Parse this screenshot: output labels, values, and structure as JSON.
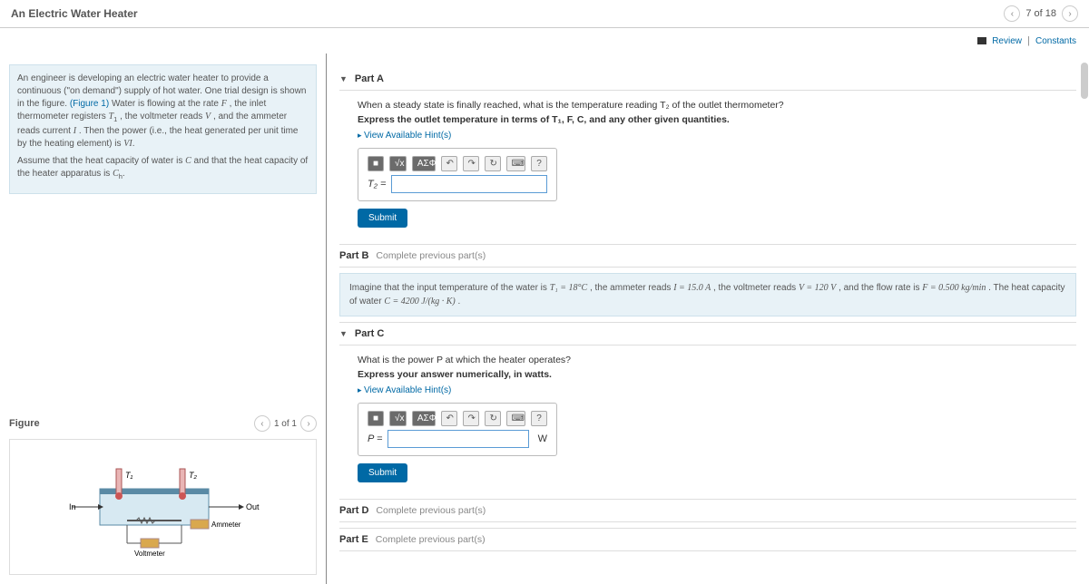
{
  "header": {
    "title": "An Electric Water Heater",
    "page_indicator": "7 of 18"
  },
  "top_links": {
    "review": "Review",
    "constants": "Constants"
  },
  "intro": {
    "p1_a": "An engineer is developing an electric water heater to provide a continuous (\"on demand\") supply of hot water. One trial design is shown in the figure. ",
    "fig_link": "(Figure 1)",
    "p1_b": "Water is flowing at the rate ",
    "p1_c": ", the inlet thermometer registers ",
    "p1_d": ", the voltmeter reads ",
    "p1_e": ", and the ammeter reads current ",
    "p1_f": ". Then the power (i.e., the heat generated per unit time by the heating element) is ",
    "p1_g": ".",
    "p2_a": "Assume that the heat capacity of water is ",
    "p2_b": " and that the heat capacity of the heater apparatus is ",
    "p2_c": "."
  },
  "figure": {
    "label": "Figure",
    "pager": "1 of 1",
    "labels": {
      "in": "In",
      "out": "Out",
      "t1": "T₁",
      "t2": "T₂",
      "amm": "Ammeter",
      "volt": "Voltmeter"
    }
  },
  "partA": {
    "title": "Part A",
    "q": "When a steady state is finally reached, what is the temperature reading T₂ of the outlet thermometer?",
    "instr": "Express the outlet temperature in terms of T₁, F, C, and any other given quantities.",
    "hint": "View Available Hint(s)",
    "tb": {
      "tmpl": "■",
      "frac": "√x",
      "greek": "ΑΣΦ",
      "undo": "↶",
      "redo": "↷",
      "reset": "↻",
      "kbd": "⌨",
      "help": "?"
    },
    "ans_label": "T₂ =",
    "submit": "Submit"
  },
  "partB": {
    "title": "Part B",
    "locked": "Complete previous part(s)",
    "banner_a": "Imagine that the input temperature of the water is ",
    "banner_b": ", the ammeter reads ",
    "banner_c": ", the voltmeter reads ",
    "banner_d": ", and the flow rate is ",
    "banner_e": ". The heat capacity of water ",
    "banner_f": ".",
    "vals": {
      "t1": "T₁ = 18°C",
      "i": "I = 15.0 A",
      "v": "V = 120 V",
      "f": "F = 0.500 kg/min",
      "c": "C = 4200 J/(kg · K)"
    }
  },
  "partC": {
    "title": "Part C",
    "q": "What is the power P at which the heater operates?",
    "instr": "Express your answer numerically, in watts.",
    "hint": "View Available Hint(s)",
    "ans_label": "P =",
    "unit": "W",
    "submit": "Submit"
  },
  "partD": {
    "title": "Part D",
    "locked": "Complete previous part(s)"
  },
  "partE": {
    "title": "Part E",
    "locked": "Complete previous part(s)"
  }
}
